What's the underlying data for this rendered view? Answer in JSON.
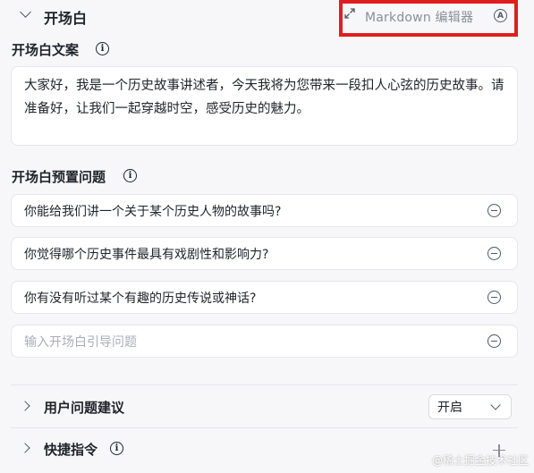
{
  "header": {
    "title": "开场白",
    "markdown_label": "Markdown 编辑器",
    "a_icon_text": "A",
    "highlight_color": "#e11d1d"
  },
  "opening_text": {
    "label": "开场白文案",
    "info_icon_text": "i",
    "value": "大家好，我是一个历史故事讲述者，今天我将为您带来一段扣人心弦的历史故事。请准备好，让我们一起穿越时空，感受历史的魅力。"
  },
  "preset_questions": {
    "label": "开场白预置问题",
    "info_icon_text": "i",
    "items": [
      "你能给我们讲一个关于某个历史人物的故事吗?",
      "你觉得哪个历史事件最具有戏剧性和影响力?",
      "你有没有听过某个有趣的历史传说或神话?"
    ],
    "input_placeholder": "输入开场白引导问题"
  },
  "user_suggestions": {
    "title": "用户问题建议",
    "select_value": "开启"
  },
  "shortcuts": {
    "title": "快捷指令",
    "info_icon_text": "i"
  },
  "watermark": "@稀土掘金技术社区"
}
